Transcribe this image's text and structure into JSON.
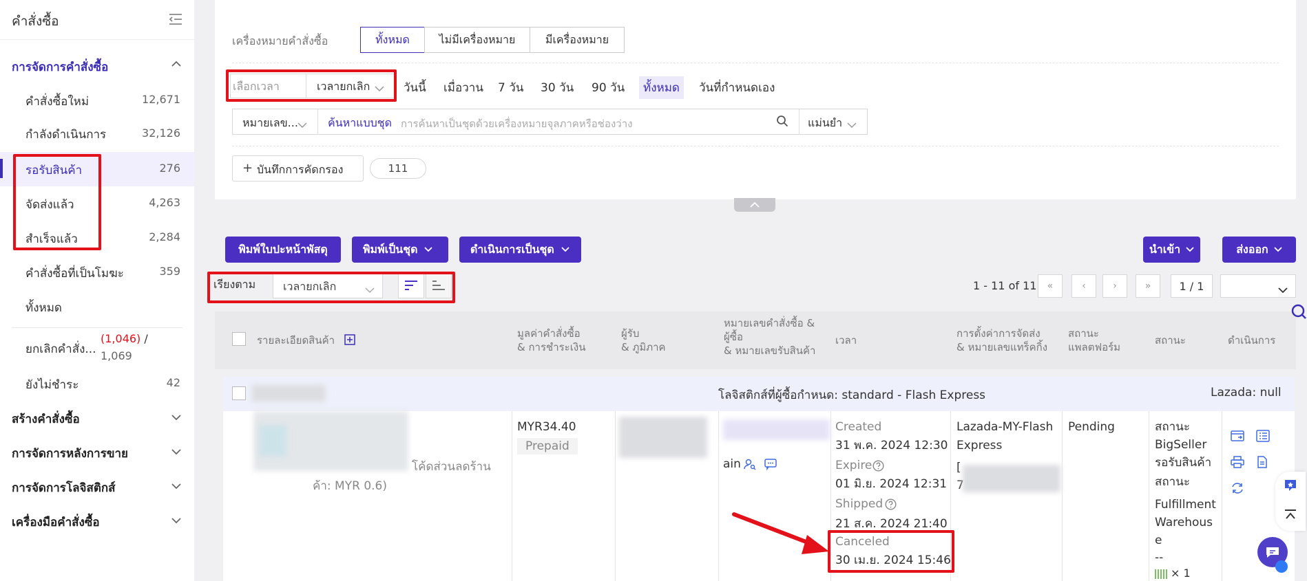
{
  "sidebar": {
    "title": "คำสั่งซื้อ",
    "section_manage": "การจัดการคำสั่งซื้อ",
    "items": [
      {
        "label": "คำสั่งซื้อใหม่",
        "count": "12,671"
      },
      {
        "label": "กำลังดำเนินการ",
        "count": "32,126"
      },
      {
        "label": "รอรับสินค้า",
        "count": "276"
      },
      {
        "label": "จัดส่งแล้ว",
        "count": "4,263"
      },
      {
        "label": "สำเร็จแล้ว",
        "count": "2,284"
      },
      {
        "label": "คำสั่งซื้อที่เป็นโมฆะ",
        "count": "359"
      },
      {
        "label": "ทั้งหมด",
        "count": ""
      }
    ],
    "cancel_label": "ยกเลิกคำสั่ง...",
    "cancel_red": "(1,046)",
    "cancel_slash": "/",
    "cancel_total": "1,069",
    "unpaid_label": "ยังไม่ชำระ",
    "unpaid_count": "42",
    "sections": [
      "สร้างคำสั่งซื้อ",
      "การจัดการหลังการขาย",
      "การจัดการโลจิสติกส์",
      "เครื่องมือคำสั่งซื้อ"
    ]
  },
  "filters": {
    "mark_label": "เครื่องหมายคำสั่งซื้อ",
    "mark_options": [
      "ทั้งหมด",
      "ไม่มีเครื่องหมาย",
      "มีเครื่องหมาย"
    ],
    "time_select_placeholder": "เลือกเวลา",
    "time_select_value": "เวลายกเลิก",
    "time_chips": [
      "วันนี้",
      "เมื่อวาน",
      "7 วัน",
      "30 วัน",
      "90 วัน",
      "ทั้งหมด",
      "วันที่กำหนดเอง"
    ],
    "search_field": "หมายเลข...",
    "search_mode": "ค้นหาแบบชุด",
    "search_placeholder": "การค้นหาเป็นชุดด้วยเครื่องหมายจุลภาคหรือช่องว่าง",
    "match_mode": "แม่นยำ",
    "save_filter": "บันทึกการคัดกรอง",
    "saved_tag": "111"
  },
  "toolbar": {
    "print_label": "พิมพ์ใบปะหน้าพัสดุ",
    "print_batch": "พิมพ์เป็นชุด",
    "batch_action": "ดำเนินการเป็นชุด",
    "import": "นำเข้า",
    "export": "ส่งออก",
    "sort_label": "เรียงตาม",
    "sort_value": "เวลายกเลิก",
    "pagination_info": "1 - 11 of 11",
    "page_indicator": "1 / 1"
  },
  "table": {
    "headers": {
      "product": "รายละเอียดสินค้า",
      "value_1": "มูลค่าคำสั่งซื้อ",
      "value_2": "& การชำระเงิน",
      "recipient_1": "ผู้รับ",
      "recipient_2": "& ภูมิภาค",
      "order_1": "หมายเลขคำสั่งซื้อ &",
      "order_2": "ผู้ซื้อ",
      "order_3": "& หมายเลขรับสินค้า",
      "time": "เวลา",
      "shipping_1": "การตั้งค่าการจัดส่ง",
      "shipping_2": "& หมายเลขแทร็คกิ้ง",
      "platform_1": "สถานะ",
      "platform_2": "แพลตฟอร์ม",
      "status": "สถานะ",
      "action": "ดำเนินการ"
    },
    "group_logistics": "โลจิสติกส์ที่ผู้ซื้อกำหนด: standard - Flash Express",
    "group_store": "Lazada: null",
    "row": {
      "discount_1": "โค้ดส่วนลดร้าน",
      "discount_2": "ค้า: MYR 0.6)",
      "amount": "MYR34.40",
      "payment": "Prepaid",
      "buyer_suffix": "ain",
      "created_label": "Created",
      "created": "31 พ.ค. 2024 12:30",
      "expire_label": "Expire",
      "expire": "01 มิ.ย. 2024 12:31",
      "shipped_label": "Shipped",
      "shipped": "21 ส.ค. 2024 21:40",
      "canceled_label": "Canceled",
      "canceled": "30 เม.ย. 2024 15:46",
      "shipping_1": "Lazada-MY-Flash",
      "shipping_2": "Express",
      "tracking_prefix": "[",
      "tracking_digit": "7",
      "platform_status": "Pending",
      "status_1": "สถานะ",
      "status_2": "BigSeller",
      "status_3": "รอรับสินค้า",
      "status_4": "สถานะ",
      "status_5": "Fulfillment",
      "status_6": "Warehous",
      "status_7": "e",
      "status_8": "--",
      "qty": "× 1"
    }
  },
  "colors": {
    "accent": "#4b2fc2",
    "annotation": "#e3111a"
  }
}
